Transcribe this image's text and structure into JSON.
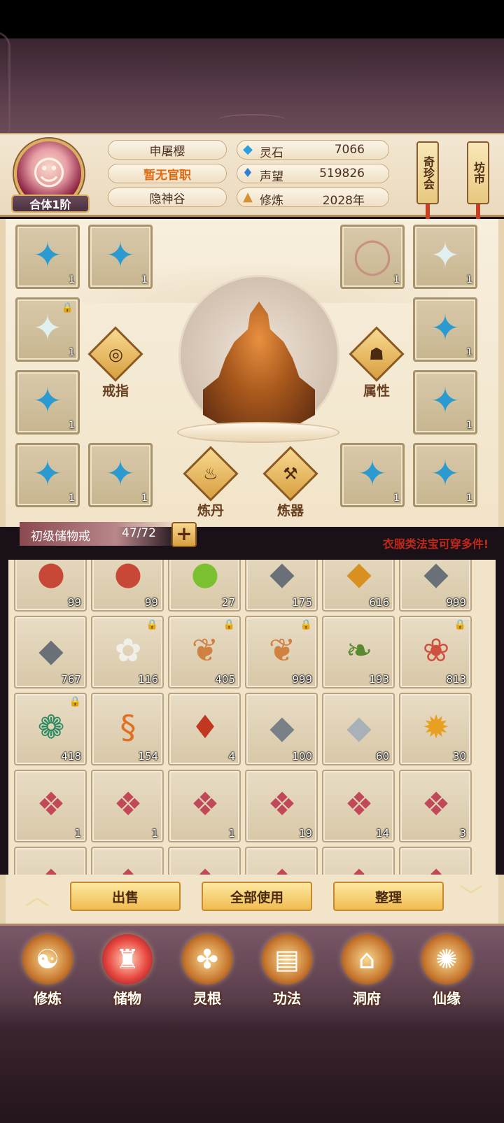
{
  "player": {
    "rank": "合体1阶",
    "name": "申屠樱",
    "title": "暂无官职",
    "sect": "隐神谷"
  },
  "resources": [
    {
      "label": "灵石",
      "value": "7066",
      "icon": "spirit-stone-icon"
    },
    {
      "label": "声望",
      "value": "519826",
      "icon": "prestige-icon"
    },
    {
      "label": "修炼",
      "value": "2028年",
      "icon": "cultivation-icon"
    }
  ],
  "shops": {
    "treasure_fair": "奇珍会",
    "market": "坊市"
  },
  "equipment": {
    "buttons": {
      "ring": "戒指",
      "attributes": "属性",
      "alchemy": "炼丹",
      "forging": "炼器"
    },
    "slots": [
      {
        "icon": "robe-icon",
        "count": "1",
        "locked": false
      },
      {
        "icon": "robe-icon",
        "count": "1",
        "locked": false
      },
      {
        "icon": "ring-icon",
        "count": "1",
        "locked": false
      },
      {
        "icon": "robe-icon",
        "count": "1",
        "locked": false
      },
      {
        "icon": "robe-icon",
        "count": "1",
        "locked": true
      },
      {
        "icon": "robe-icon",
        "count": "1",
        "locked": false
      },
      {
        "icon": "robe-icon",
        "count": "1",
        "locked": false
      },
      {
        "icon": "robe-icon",
        "count": "1",
        "locked": false
      },
      {
        "icon": "robe-icon",
        "count": "1",
        "locked": false
      },
      {
        "icon": "robe-icon",
        "count": "1",
        "locked": false
      },
      {
        "icon": "robe-icon",
        "count": "1",
        "locked": false
      },
      {
        "icon": "robe-icon",
        "count": "1",
        "locked": false
      }
    ]
  },
  "storage": {
    "title": "初级储物戒",
    "count": "47/72",
    "hint": "衣服类法宝可穿多件!"
  },
  "inventory": [
    {
      "icon": "red-orb-icon",
      "count": "99",
      "locked": false
    },
    {
      "icon": "red-orb-icon",
      "count": "99",
      "locked": false
    },
    {
      "icon": "green-orb-icon",
      "count": "27",
      "locked": false
    },
    {
      "icon": "ore-icon",
      "count": "175",
      "locked": false
    },
    {
      "icon": "gold-ore-icon",
      "count": "616",
      "locked": false
    },
    {
      "icon": "ore-icon",
      "count": "999",
      "locked": false
    },
    {
      "icon": "ore-icon",
      "count": "767",
      "locked": false
    },
    {
      "icon": "lily-icon",
      "count": "116",
      "locked": true
    },
    {
      "icon": "ginseng-icon",
      "count": "405",
      "locked": true
    },
    {
      "icon": "ginseng-icon",
      "count": "999",
      "locked": true
    },
    {
      "icon": "herb-icon",
      "count": "193",
      "locked": false
    },
    {
      "icon": "flower-herb-icon",
      "count": "813",
      "locked": true
    },
    {
      "icon": "berry-branch-icon",
      "count": "418",
      "locked": true
    },
    {
      "icon": "worm-icon",
      "count": "154",
      "locked": false
    },
    {
      "icon": "red-crystal-icon",
      "count": "4",
      "locked": false
    },
    {
      "icon": "gray-ore-icon",
      "count": "100",
      "locked": false
    },
    {
      "icon": "silver-ore-icon",
      "count": "60",
      "locked": false
    },
    {
      "icon": "lotus-pod-icon",
      "count": "30",
      "locked": false
    },
    {
      "icon": "scroll-gift-icon",
      "count": "1",
      "locked": false
    },
    {
      "icon": "scroll-gift-icon",
      "count": "1",
      "locked": false
    },
    {
      "icon": "scroll-gift-icon",
      "count": "1",
      "locked": false
    },
    {
      "icon": "scroll-gift-icon",
      "count": "19",
      "locked": false
    },
    {
      "icon": "scroll-gift-icon",
      "count": "14",
      "locked": false
    },
    {
      "icon": "scroll-gift-icon",
      "count": "3",
      "locked": false
    },
    {
      "icon": "scroll-gift-icon",
      "count": "",
      "locked": false
    },
    {
      "icon": "scroll-gift-icon",
      "count": "",
      "locked": false
    },
    {
      "icon": "scroll-gift-icon",
      "count": "",
      "locked": false
    },
    {
      "icon": "scroll-gift-icon",
      "count": "",
      "locked": false
    },
    {
      "icon": "scroll-gift-icon",
      "count": "",
      "locked": false
    },
    {
      "icon": "scroll-gift-icon",
      "count": "",
      "locked": false
    }
  ],
  "actions": {
    "sell": "出售",
    "use_all": "全部使用",
    "organize": "整理"
  },
  "nav": [
    {
      "label": "修炼",
      "icon": "cultivate-icon",
      "active": false
    },
    {
      "label": "储物",
      "icon": "storage-bag-icon",
      "active": true
    },
    {
      "label": "灵根",
      "icon": "spirit-root-icon",
      "active": false
    },
    {
      "label": "功法",
      "icon": "technique-book-icon",
      "active": false
    },
    {
      "label": "洞府",
      "icon": "cave-abode-icon",
      "active": false
    },
    {
      "label": "仙缘",
      "icon": "immortal-fate-icon",
      "active": false
    }
  ]
}
